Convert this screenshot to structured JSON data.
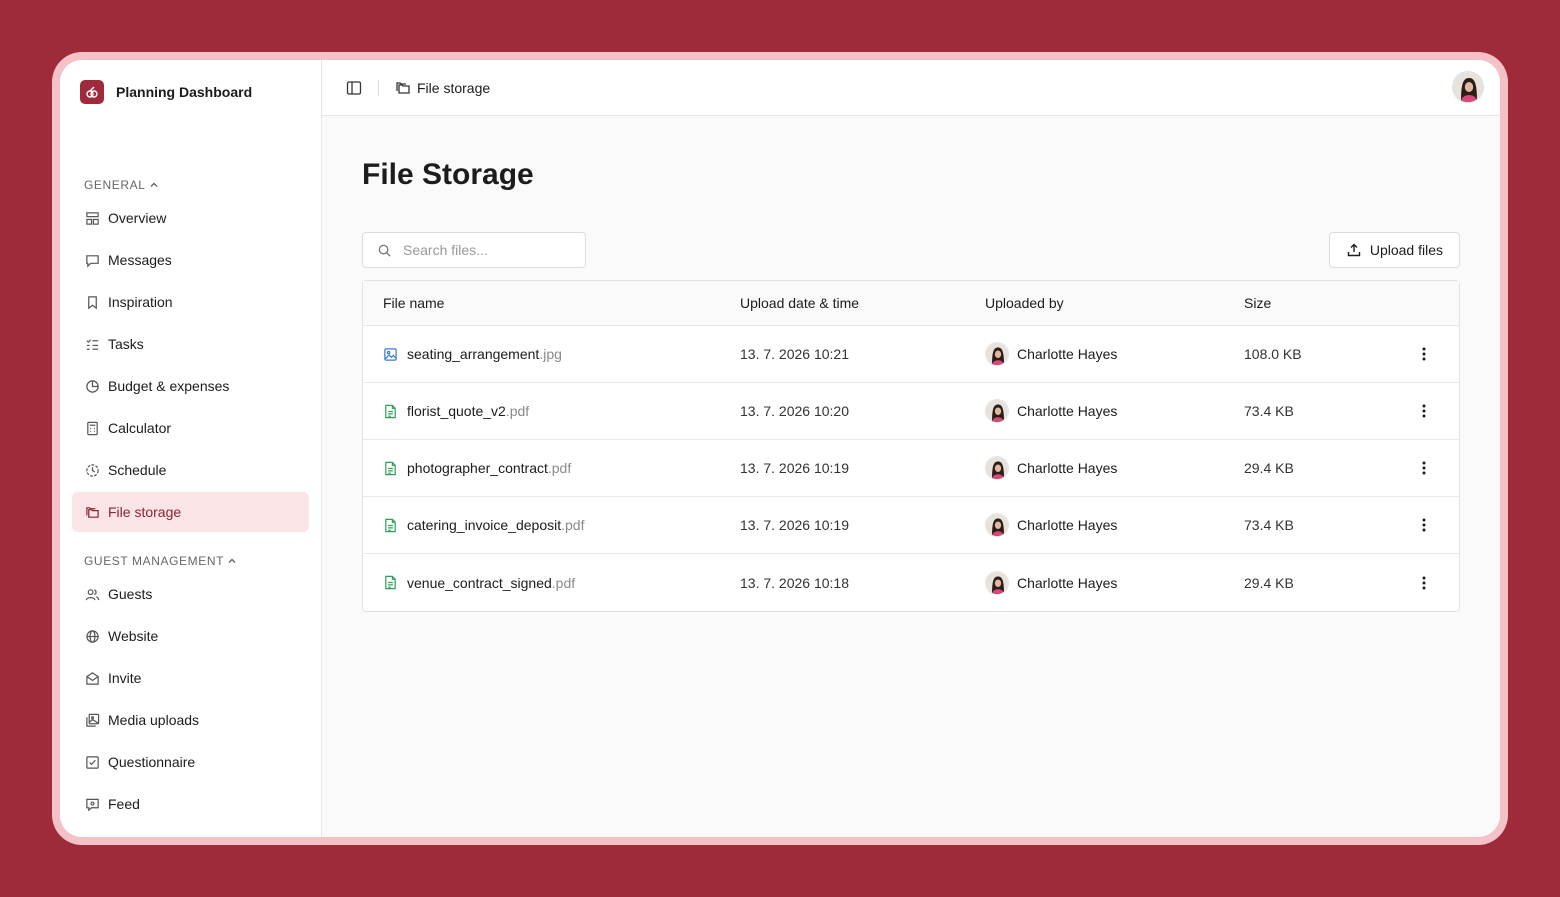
{
  "app": {
    "title": "Planning Dashboard",
    "accent_color": "#9e2a3a",
    "active_bg": "#fbe4e6"
  },
  "sidebar": {
    "sections": [
      {
        "label": "GENERAL",
        "items": [
          {
            "label": "Overview",
            "icon": "layout-icon"
          },
          {
            "label": "Messages",
            "icon": "message-icon"
          },
          {
            "label": "Inspiration",
            "icon": "bookmark-icon"
          },
          {
            "label": "Tasks",
            "icon": "checklist-icon"
          },
          {
            "label": "Budget & expenses",
            "icon": "pie-chart-icon"
          },
          {
            "label": "Calculator",
            "icon": "calculator-icon"
          },
          {
            "label": "Schedule",
            "icon": "clock-icon"
          },
          {
            "label": "File storage",
            "icon": "folders-icon",
            "active": true
          }
        ]
      },
      {
        "label": "GUEST MANAGEMENT",
        "items": [
          {
            "label": "Guests",
            "icon": "users-icon"
          },
          {
            "label": "Website",
            "icon": "globe-icon"
          },
          {
            "label": "Invite",
            "icon": "envelope-icon"
          },
          {
            "label": "Media uploads",
            "icon": "images-icon"
          },
          {
            "label": "Questionnaire",
            "icon": "checkbox-icon"
          },
          {
            "label": "Feed",
            "icon": "feed-icon"
          }
        ]
      }
    ]
  },
  "topbar": {
    "breadcrumb": "File storage"
  },
  "main": {
    "title": "File Storage",
    "search_placeholder": "Search files...",
    "upload_label": "Upload files",
    "table": {
      "columns": [
        "File name",
        "Upload date & time",
        "Uploaded by",
        "Size"
      ],
      "rows": [
        {
          "name": "seating_arrangement",
          "ext": ".jpg",
          "type": "image",
          "date": "13. 7. 2026 10:21",
          "user": "Charlotte Hayes",
          "size": "108.0 KB"
        },
        {
          "name": "florist_quote_v2",
          "ext": ".pdf",
          "type": "document",
          "date": "13. 7. 2026 10:20",
          "user": "Charlotte Hayes",
          "size": "73.4 KB"
        },
        {
          "name": "photographer_contract",
          "ext": ".pdf",
          "type": "document",
          "date": "13. 7. 2026 10:19",
          "user": "Charlotte Hayes",
          "size": "29.4 KB"
        },
        {
          "name": "catering_invoice_deposit",
          "ext": ".pdf",
          "type": "document",
          "date": "13. 7. 2026 10:19",
          "user": "Charlotte Hayes",
          "size": "73.4 KB"
        },
        {
          "name": "venue_contract_signed",
          "ext": ".pdf",
          "type": "document",
          "date": "13. 7. 2026 10:18",
          "user": "Charlotte Hayes",
          "size": "29.4 KB"
        }
      ]
    }
  }
}
